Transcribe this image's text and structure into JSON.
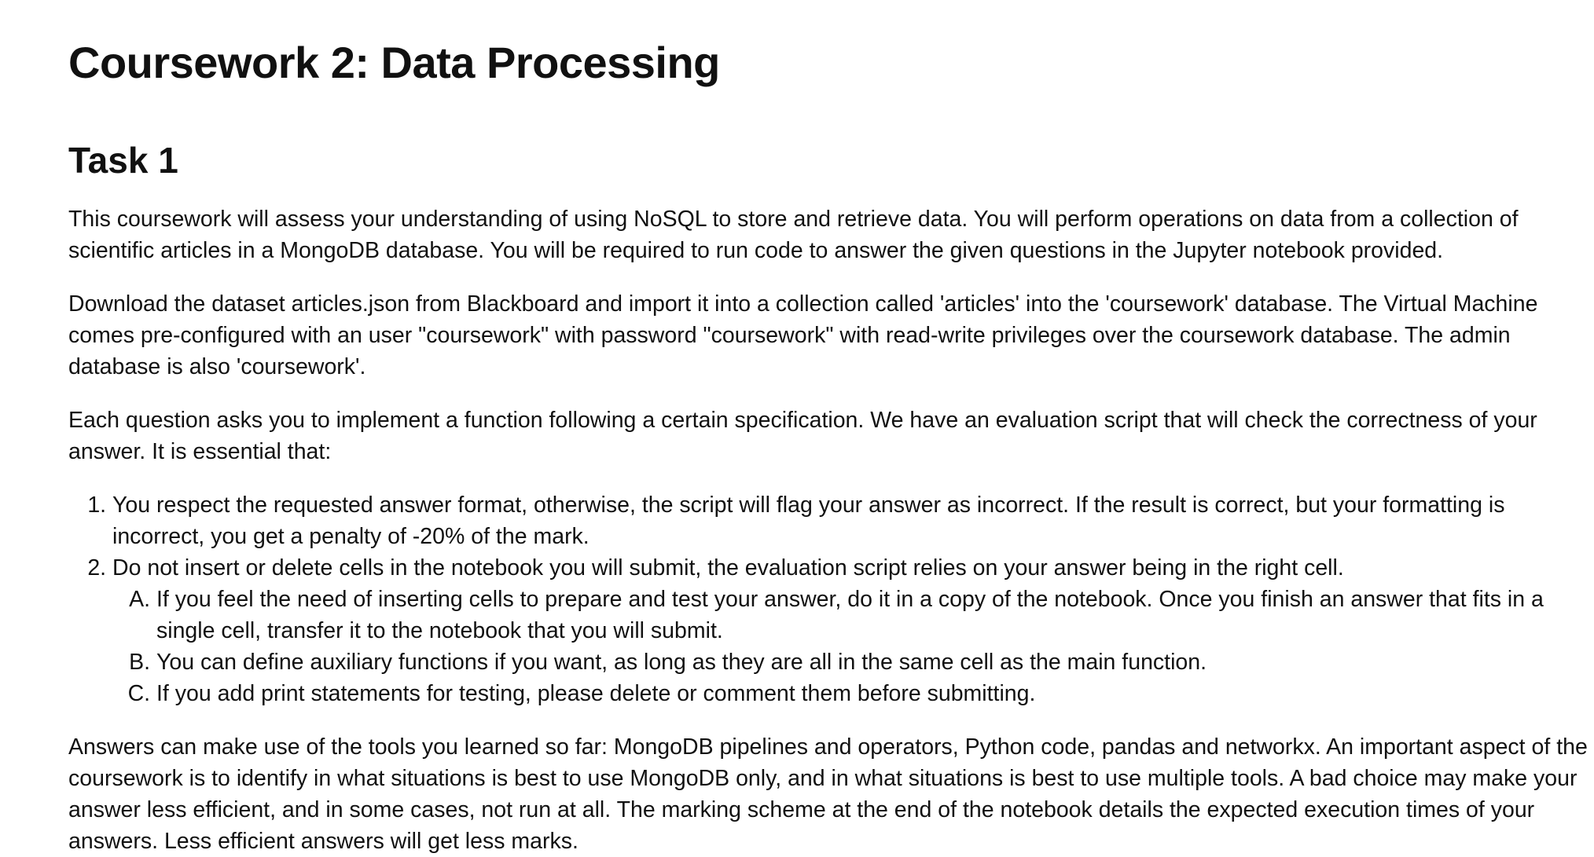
{
  "doc": {
    "title": "Coursework 2: Data Processing",
    "task_heading": "Task 1",
    "paragraphs": [
      "This coursework will assess your understanding of using NoSQL to store and retrieve data. You will perform operations on data from a collection of scientific articles in a MongoDB database. You will be required to run code to answer the given questions in the Jupyter notebook provided.",
      "Download the dataset articles.json from Blackboard and import it into a collection called 'articles' into the 'coursework' database. The Virtual Machine comes pre-configured with an user \"coursework\" with password \"coursework\" with read-write privileges over the coursework database. The admin database is also 'coursework'.",
      "Each question asks you to implement a function following a certain specification. We have an evaluation script that will check the correctness of your answer. It is essential that:",
      "Answers can make use of the tools you learned so far: MongoDB pipelines and operators, Python code, pandas and networkx. An important aspect of the coursework is to identify in what situations is best to use MongoDB only, and in what situations is best to use multiple tools. A bad choice may make your answer less efficient, and in some cases, not run at all. The marking scheme at the end of the notebook details the expected execution times of your answers. Less efficient answers will get less marks."
    ],
    "list": [
      "You respect the requested answer format, otherwise, the script will flag your answer as incorrect. If the result is correct, but your formatting is incorrect, you get a penalty of -20% of the mark.",
      "Do not insert or delete cells in the notebook you will submit, the evaluation script relies on your answer being in the right cell."
    ],
    "sublist": [
      "If you feel the need of inserting cells to prepare and test your answer, do it in a copy of the notebook. Once you finish an answer that fits in a single cell, transfer it to the notebook that you will submit.",
      "You can define auxiliary functions if you want, as long as they are all in the same cell as the main function.",
      "If you add print statements for testing, please delete or comment them before submitting."
    ]
  }
}
